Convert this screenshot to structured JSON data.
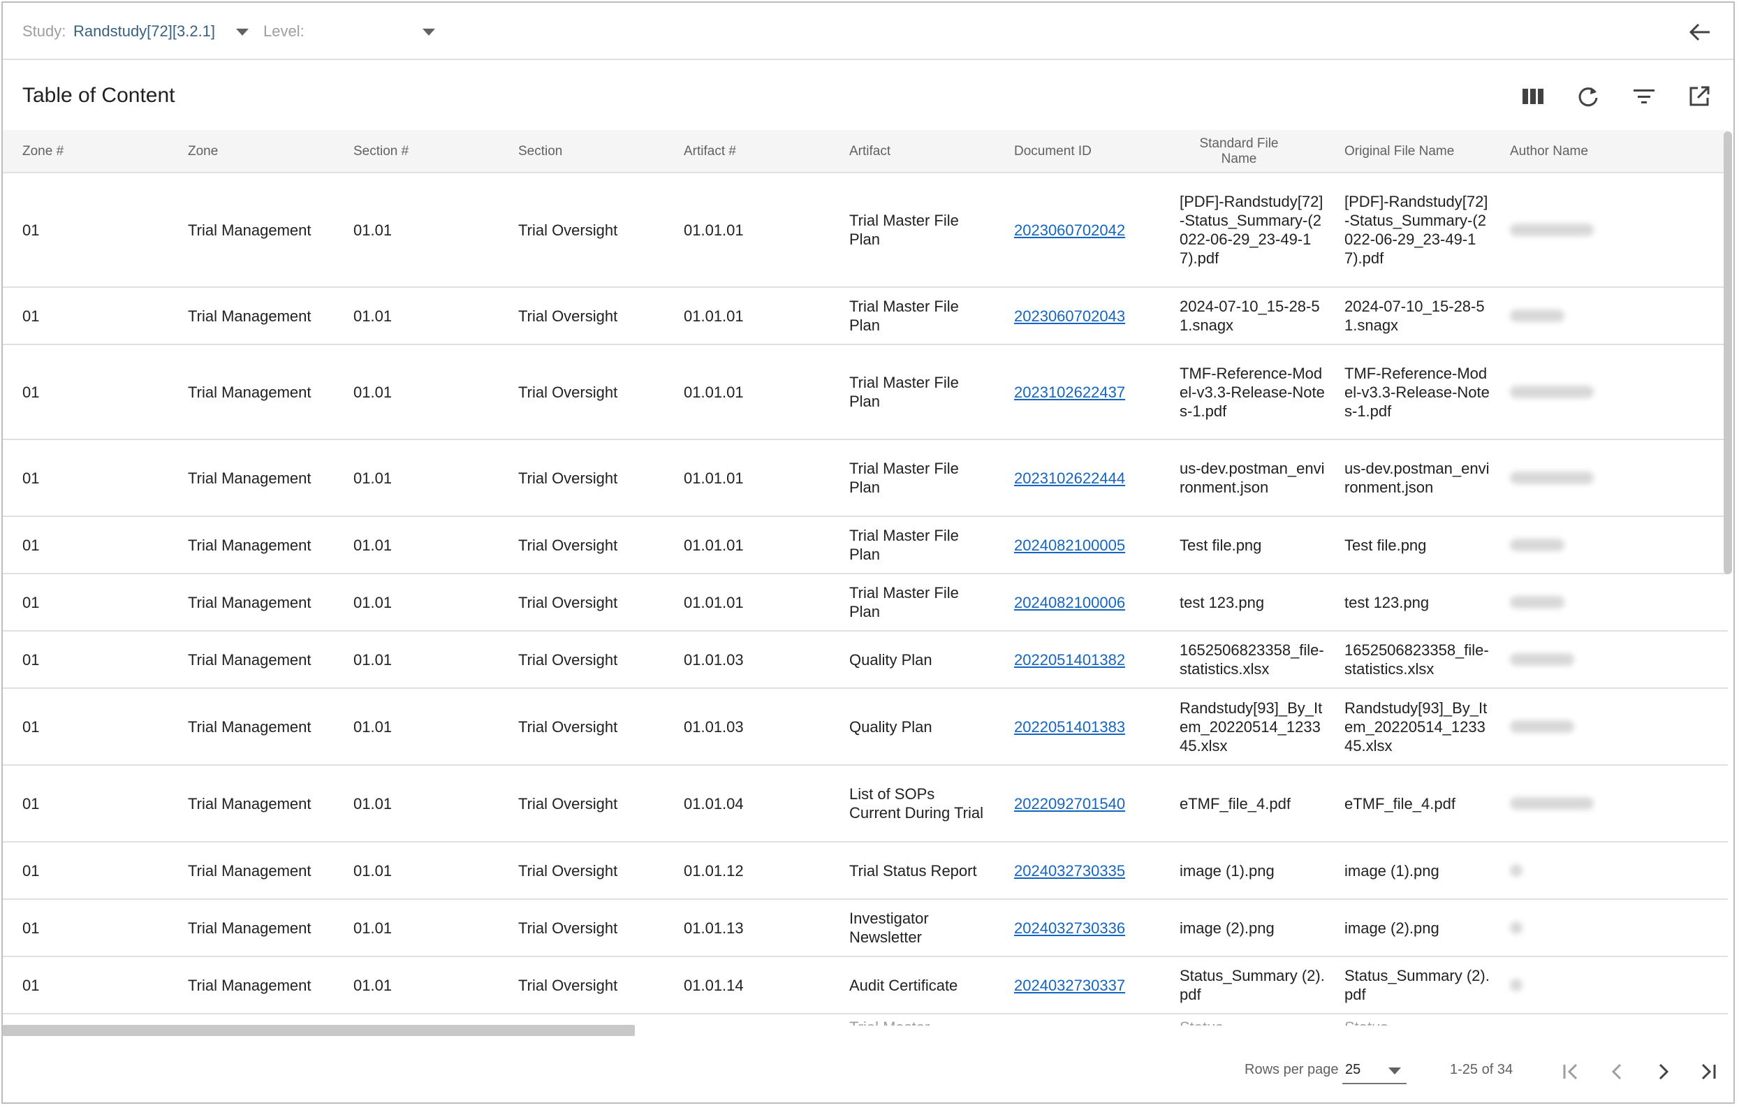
{
  "toolbar": {
    "study_label": "Study:",
    "study_value": "Randstudy[72][3.2.1]",
    "level_label": "Level:",
    "level_value": ""
  },
  "title": "Table of Content",
  "icons": {
    "back": "arrow-left-icon",
    "columns": "view-columns-icon",
    "refresh": "refresh-icon",
    "filter": "filter-icon",
    "export": "open-in-new-icon"
  },
  "columns": [
    "Zone #",
    "Zone",
    "Section #",
    "Section",
    "Artifact #",
    "Artifact",
    "Document ID",
    "Standard File Name",
    "Original File Name",
    "Author Name"
  ],
  "rows": [
    {
      "zone_no": "01",
      "zone": "Trial Management",
      "section_no": "01.01",
      "section": "Trial Oversight",
      "artifact_no": "01.01.01",
      "artifact": "Trial Master File Plan",
      "doc_id": "2023060702042",
      "std_name": "[PDF]-Randstudy[72]-Status_Summary-(2022-06-29_23-49-17).pdf",
      "orig_name": "[PDF]-Randstudy[72]-Status_Summary-(2022-06-29_23-49-17).pdf"
    },
    {
      "zone_no": "01",
      "zone": "Trial Management",
      "section_no": "01.01",
      "section": "Trial Oversight",
      "artifact_no": "01.01.01",
      "artifact": "Trial Master File Plan",
      "doc_id": "2023060702043",
      "std_name": "2024-07-10_15-28-51.snagx",
      "orig_name": "2024-07-10_15-28-51.snagx"
    },
    {
      "zone_no": "01",
      "zone": "Trial Management",
      "section_no": "01.01",
      "section": "Trial Oversight",
      "artifact_no": "01.01.01",
      "artifact": "Trial Master File Plan",
      "doc_id": "2023102622437",
      "std_name": "TMF-Reference-Model-v3.3-Release-Notes-1.pdf",
      "orig_name": "TMF-Reference-Model-v3.3-Release-Notes-1.pdf"
    },
    {
      "zone_no": "01",
      "zone": "Trial Management",
      "section_no": "01.01",
      "section": "Trial Oversight",
      "artifact_no": "01.01.01",
      "artifact": "Trial Master File Plan",
      "doc_id": "2023102622444",
      "std_name": "us-dev.postman_environment.json",
      "orig_name": "us-dev.postman_environment.json"
    },
    {
      "zone_no": "01",
      "zone": "Trial Management",
      "section_no": "01.01",
      "section": "Trial Oversight",
      "artifact_no": "01.01.01",
      "artifact": "Trial Master File Plan",
      "doc_id": "2024082100005",
      "std_name": "Test file.png",
      "orig_name": "Test file.png"
    },
    {
      "zone_no": "01",
      "zone": "Trial Management",
      "section_no": "01.01",
      "section": "Trial Oversight",
      "artifact_no": "01.01.01",
      "artifact": "Trial Master File Plan",
      "doc_id": "2024082100006",
      "std_name": "test 123.png",
      "orig_name": "test 123.png"
    },
    {
      "zone_no": "01",
      "zone": "Trial Management",
      "section_no": "01.01",
      "section": "Trial Oversight",
      "artifact_no": "01.01.03",
      "artifact": "Quality Plan",
      "doc_id": "2022051401382",
      "std_name": "1652506823358_file-statistics.xlsx",
      "orig_name": "1652506823358_file-statistics.xlsx"
    },
    {
      "zone_no": "01",
      "zone": "Trial Management",
      "section_no": "01.01",
      "section": "Trial Oversight",
      "artifact_no": "01.01.03",
      "artifact": "Quality Plan",
      "doc_id": "2022051401383",
      "std_name": "Randstudy[93]_By_Item_20220514_123345.xlsx",
      "orig_name": "Randstudy[93]_By_Item_20220514_123345.xlsx"
    },
    {
      "zone_no": "01",
      "zone": "Trial Management",
      "section_no": "01.01",
      "section": "Trial Oversight",
      "artifact_no": "01.01.04",
      "artifact": "List of SOPs Current During Trial",
      "doc_id": "2022092701540",
      "std_name": "eTMF_file_4.pdf",
      "orig_name": "eTMF_file_4.pdf"
    },
    {
      "zone_no": "01",
      "zone": "Trial Management",
      "section_no": "01.01",
      "section": "Trial Oversight",
      "artifact_no": "01.01.12",
      "artifact": "Trial Status Report",
      "doc_id": "2024032730335",
      "std_name": "image (1).png",
      "orig_name": "image (1).png"
    },
    {
      "zone_no": "01",
      "zone": "Trial Management",
      "section_no": "01.01",
      "section": "Trial Oversight",
      "artifact_no": "01.01.13",
      "artifact": "Investigator Newsletter",
      "doc_id": "2024032730336",
      "std_name": "image (2).png",
      "orig_name": "image (2).png"
    },
    {
      "zone_no": "01",
      "zone": "Trial Management",
      "section_no": "01.01",
      "section": "Trial Oversight",
      "artifact_no": "01.01.14",
      "artifact": "Audit Certificate",
      "doc_id": "2024032730337",
      "std_name": "Status_Summary (2).pdf",
      "orig_name": "Status_Summary (2).pdf"
    }
  ],
  "pagination": {
    "rows_per_page_label": "Rows per page",
    "rows_per_page_value": "25",
    "range": "1-25 of 34"
  },
  "colors": {
    "link": "#1565c0",
    "study_value": "#37627f",
    "header_bg": "#f5f5f5"
  }
}
